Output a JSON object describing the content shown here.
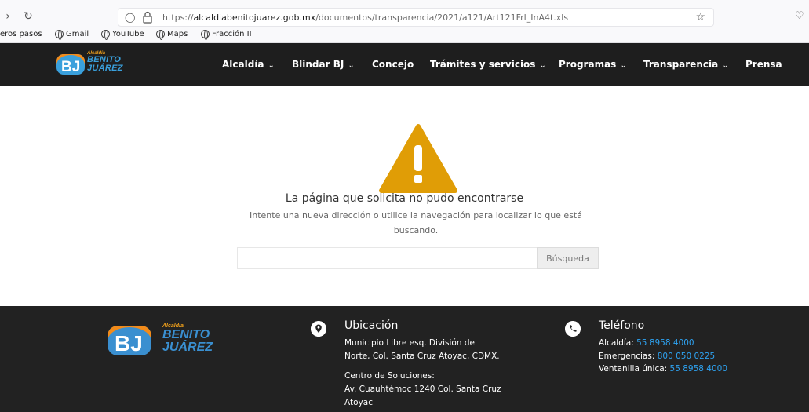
{
  "browser": {
    "url_prefix": "https://",
    "url_domain": "alcaldiabenitojuarez.gob.mx",
    "url_path": "/documentos/transparencia/2021/a121/Art121Frl_InA4t.xls",
    "bookmarks": [
      {
        "label": "eros pasos"
      },
      {
        "label": "Gmail"
      },
      {
        "label": "YouTube"
      },
      {
        "label": "Maps"
      },
      {
        "label": "Fracción II"
      }
    ]
  },
  "logo": {
    "small": "Alcaldía",
    "line1": "BENITO",
    "line2": "JUÁREZ"
  },
  "menu": [
    {
      "label": "Alcaldía",
      "chevron": true
    },
    {
      "label": "Blindar BJ",
      "chevron": true
    },
    {
      "label": "Concejo",
      "chevron": false
    },
    {
      "label": "Trámites y servicios",
      "chevron": true
    },
    {
      "label": "Programas",
      "chevron": true
    },
    {
      "label": "Transparencia",
      "chevron": true
    },
    {
      "label": "Prensa",
      "chevron": false
    }
  ],
  "error": {
    "headline": "La página que solicita no pudo encontrarse",
    "subline": "Intente una nueva dirección o utilice la navegación para localizar lo que está buscando.",
    "search_button": "Búsqueda",
    "search_value": ""
  },
  "footer": {
    "location": {
      "title": "Ubicación",
      "lines": [
        "Municipio Libre esq. División del",
        "Norte, Col. Santa Cruz Atoyac, CDMX.",
        "Centro de Soluciones:",
        "Av. Cuauhtémoc 1240 Col. Santa Cruz",
        "Atoyac"
      ]
    },
    "phone": {
      "title": "Teléfono",
      "rows": [
        {
          "label": "Alcaldía:",
          "number": "55 8958 4000"
        },
        {
          "label": "Emergencias:",
          "number": "800 050 0225"
        },
        {
          "label": "Ventanilla única:",
          "number": "55 8958 4000"
        }
      ]
    }
  },
  "colors": {
    "header_bg": "#1e1e1e",
    "footer_bg": "#222222",
    "warning": "#e09d06",
    "link": "#2ea3f2"
  }
}
